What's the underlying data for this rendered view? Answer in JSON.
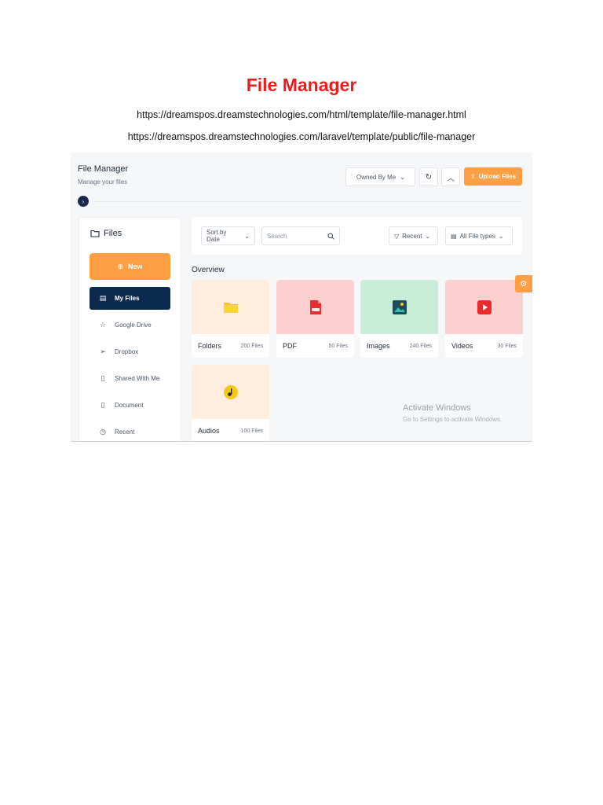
{
  "document": {
    "title": "File Manager",
    "links": [
      "https://dreamspos.dreamstechnologies.com/html/template/file-manager.html",
      "https://dreamspos.dreamstechnologies.com/laravel/template/public/file-manager"
    ]
  },
  "app": {
    "title": "File Manager",
    "subtitle": "Manage your files",
    "owned_filter": "Owned By Me",
    "upload_label": "Upload Files",
    "accent_color": "#fe9f43",
    "active_nav_color": "#0c2a4d"
  },
  "sidebar": {
    "heading": "Files",
    "new_label": "New",
    "items": [
      {
        "label": "My Files",
        "icon": "file-icon"
      },
      {
        "label": "Google Drive",
        "icon": "star-icon"
      },
      {
        "label": "Dropbox",
        "icon": "send-icon"
      },
      {
        "label": "Shared With Me",
        "icon": "file-icon"
      },
      {
        "label": "Document",
        "icon": "file-icon"
      },
      {
        "label": "Recent",
        "icon": "clock-icon"
      }
    ]
  },
  "filters": {
    "sort": "Sort by Date",
    "search_placeholder": "Search",
    "recent": "Recent",
    "file_types": "All File types"
  },
  "overview": {
    "label": "Overview",
    "cards": [
      {
        "name": "Folders",
        "count": "200 Files",
        "icon": "folder-icon"
      },
      {
        "name": "PDF",
        "count": "50 Files",
        "icon": "pdf-icon"
      },
      {
        "name": "Images",
        "count": "240 Files",
        "icon": "image-icon"
      },
      {
        "name": "Videos",
        "count": "30 Files",
        "icon": "video-icon"
      },
      {
        "name": "Audios",
        "count": "100 Files",
        "icon": "music-icon"
      }
    ]
  },
  "watermark": {
    "title": "Activate Windows",
    "subtitle": "Go to Settings to activate Windows."
  }
}
